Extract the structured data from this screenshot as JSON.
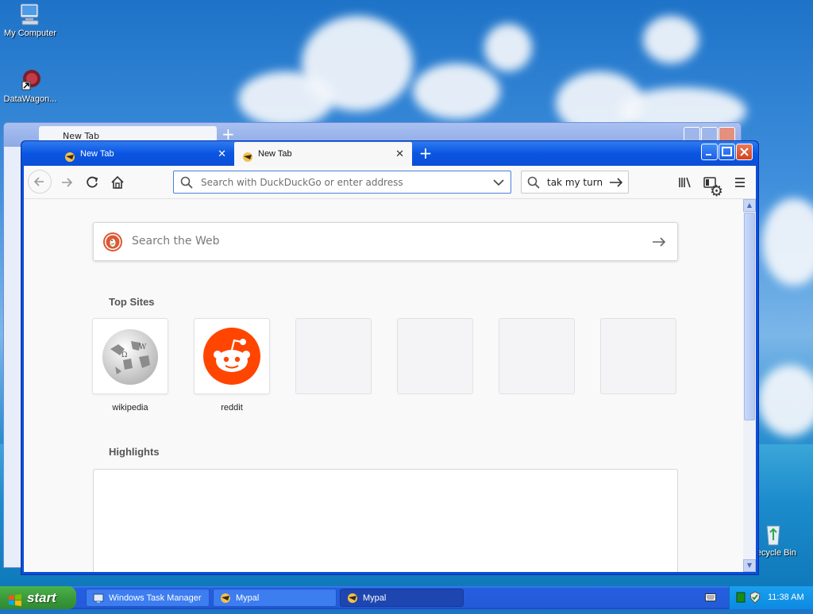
{
  "desktop": {
    "icons": [
      {
        "label": "My Computer"
      },
      {
        "label": "DataWagon..."
      },
      {
        "label": "Recycle Bin"
      }
    ]
  },
  "background_window": {
    "tab_title": "New Tab"
  },
  "browser": {
    "tabs": [
      {
        "title": "New Tab",
        "state": "inactive"
      },
      {
        "title": "New Tab",
        "state": "active"
      }
    ],
    "urlbar": {
      "placeholder": "Search with DuckDuckGo or enter address",
      "value": ""
    },
    "search_field": {
      "value": "tak my turn"
    },
    "newtab_page": {
      "search_placeholder": "Search the Web",
      "top_sites_title": "Top Sites",
      "top_sites": [
        {
          "label": "wikipedia",
          "icon": "wikipedia-globe-icon"
        },
        {
          "label": "reddit",
          "icon": "reddit-alien-icon"
        },
        {
          "label": "",
          "icon": ""
        },
        {
          "label": "",
          "icon": ""
        },
        {
          "label": "",
          "icon": ""
        },
        {
          "label": "",
          "icon": ""
        }
      ],
      "highlights_title": "Highlights"
    }
  },
  "taskbar": {
    "start_label": "start",
    "tasks": [
      {
        "label": "Windows Task Manager",
        "active": false
      },
      {
        "label": "Mypal",
        "active": false
      },
      {
        "label": "Mypal",
        "active": true
      }
    ],
    "clock": "11:38 AM"
  },
  "colors": {
    "xp_blue": "#0b55e2",
    "start_green": "#3c9a3c",
    "reddit_orange": "#ff4500",
    "ddg_orange": "#de5833",
    "close_red": "#d4421e"
  }
}
